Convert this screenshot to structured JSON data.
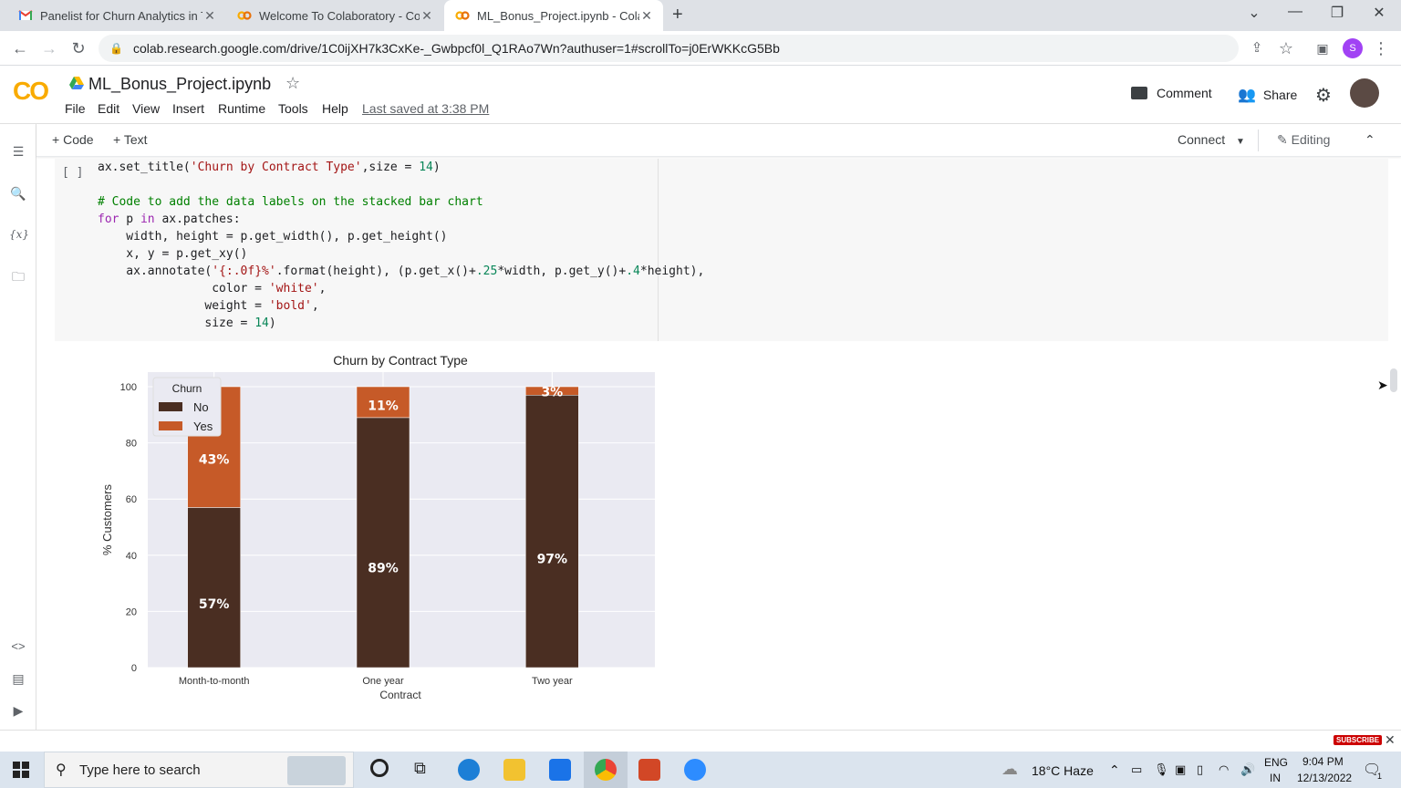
{
  "browser": {
    "tabs": [
      {
        "title": "Panelist for Churn Analytics in Te",
        "icon": "gmail-icon",
        "active": false
      },
      {
        "title": "Welcome To Colaboratory - Cola",
        "icon": "colab-icon",
        "active": false
      },
      {
        "title": "ML_Bonus_Project.ipynb - Colab",
        "icon": "colab-icon",
        "active": true
      }
    ],
    "url": "colab.research.google.com/drive/1C0ijXH7k3CxKe-_Gwbpcf0l_Q1RAo7Wn?authuser=1#scrollTo=j0ErWKKcG5Bb",
    "profile_initial": "S"
  },
  "colab": {
    "logo": "CO",
    "notebook_name": "ML_Bonus_Project.ipynb",
    "menu": [
      "File",
      "Edit",
      "View",
      "Insert",
      "Runtime",
      "Tools",
      "Help"
    ],
    "last_saved": "Last saved at 3:38 PM",
    "comment_label": "Comment",
    "share_label": "Share",
    "toolbar": {
      "code": "Code",
      "text": "Text",
      "connect": "Connect",
      "editing": "Editing"
    }
  },
  "cell": {
    "run_indicator": "[ ]",
    "lines": [
      "ax.set_title('Churn by Contract Type',size = 14)",
      "",
      "# Code to add the data labels on the stacked bar chart",
      "for p in ax.patches:",
      "    width, height = p.get_width(), p.get_height()",
      "    x, y = p.get_xy()",
      "    ax.annotate('{:.0f}%'.format(height), (p.get_x()+.25*width, p.get_y()+.4*height),",
      "                color = 'white',",
      "               weight = 'bold',",
      "               size = 14)"
    ]
  },
  "chart_data": {
    "type": "bar",
    "stacked": true,
    "title": "Churn by Contract Type",
    "xlabel": "Contract",
    "ylabel": "% Customers",
    "categories": [
      "Month-to-month",
      "One year",
      "Two year"
    ],
    "series": [
      {
        "name": "No",
        "values": [
          57,
          89,
          97
        ],
        "color": "#4a2e22",
        "labels": [
          "57%",
          "89%",
          "97%"
        ]
      },
      {
        "name": "Yes",
        "values": [
          43,
          11,
          3
        ],
        "color": "#c65a28",
        "labels": [
          "43%",
          "11%",
          "3%"
        ]
      }
    ],
    "ylim": [
      0,
      100
    ],
    "yticks": [
      0,
      20,
      40,
      60,
      80,
      100
    ],
    "legend_title": "Churn",
    "legend_position": "top-left",
    "grid": true
  },
  "taskbar": {
    "search_placeholder": "Type here to search",
    "weather": "18°C Haze",
    "lang_top": "ENG",
    "lang_bottom": "IN",
    "time": "9:04 PM",
    "date": "12/13/2022",
    "notification_count": "1",
    "subscribe": "SUBSCRIBE"
  }
}
